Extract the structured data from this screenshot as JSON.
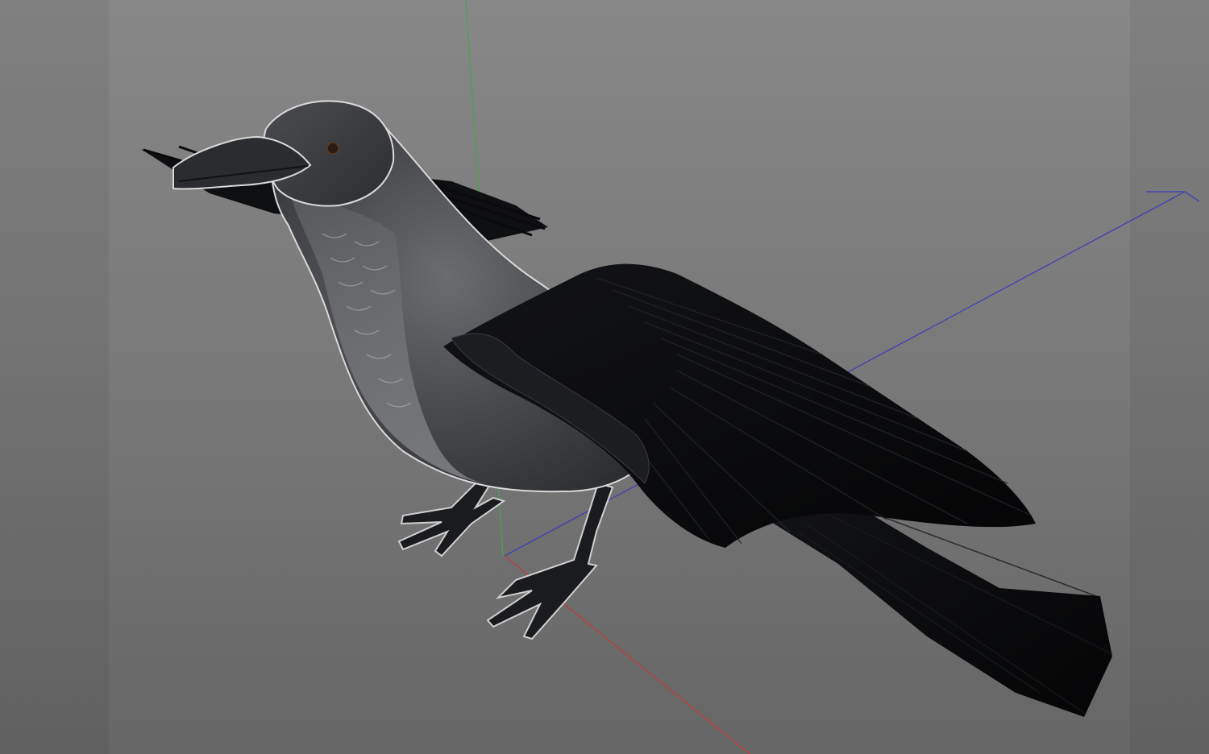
{
  "viewport": {
    "background_top": "#878787",
    "background_bottom": "#666666"
  },
  "axes": {
    "x_color": "#c43a3a",
    "y_color": "#3fa84a",
    "z_color": "#3b3bb8"
  },
  "model": {
    "name": "crow",
    "body_color": "#3f4044",
    "feather_color": "#0d0e10",
    "highlight_outline": "#d9d9d9"
  }
}
